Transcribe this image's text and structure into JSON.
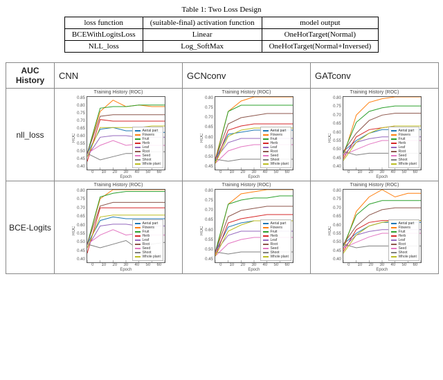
{
  "caption": "Table 1: Two Loss Design",
  "top_table": {
    "headers": [
      "loss function",
      "(suitable-final) activation function",
      "model output"
    ],
    "rows": [
      [
        "BCEWithLogitsLoss",
        "Linear",
        "OneHotTarget(Normal)"
      ],
      [
        "NLL_loss",
        "Log_SoftMax",
        "OneHotTarget(Normal+Inversed)"
      ]
    ]
  },
  "grid": {
    "corner": "AUC History",
    "cols": [
      "CNN",
      "GCNconv",
      "GATconv"
    ],
    "rows": [
      "nll_loss",
      "BCE-Logits"
    ]
  },
  "legend_labels": [
    "Aerial part",
    "Flowers",
    "Fruit",
    "Herb",
    "Leaf",
    "Root",
    "Seed",
    "Shoot",
    "Whole plant"
  ],
  "legend_colors": [
    "#1f77b4",
    "#ff7f0e",
    "#2ca02c",
    "#d62728",
    "#9467bd",
    "#8c564b",
    "#e377c2",
    "#7f7f7f",
    "#bcbd22"
  ],
  "chart_meta": {
    "title": "Training History (ROC)",
    "xlabel": "Epoch",
    "ylabel": "ROC",
    "xticks": [
      "0",
      "10",
      "20",
      "30",
      "40",
      "50",
      "60"
    ]
  },
  "chart_data": [
    {
      "row": "nll_loss",
      "col": "CNN",
      "type": "line",
      "x": [
        0,
        10,
        20,
        30,
        40,
        50,
        60
      ],
      "ylim": [
        0.4,
        0.85
      ],
      "yticks": [
        "0.85",
        "0.80",
        "0.75",
        "0.70",
        "0.65",
        "0.60",
        "0.55",
        "0.50",
        "0.45",
        "0.40"
      ],
      "series": [
        {
          "name": "Aerial part",
          "values": [
            0.5,
            0.65,
            0.66,
            0.64,
            0.64,
            0.63,
            0.63
          ]
        },
        {
          "name": "Flowers",
          "values": [
            0.5,
            0.76,
            0.83,
            0.79,
            0.8,
            0.79,
            0.79
          ]
        },
        {
          "name": "Fruit",
          "values": [
            0.5,
            0.78,
            0.79,
            0.79,
            0.8,
            0.8,
            0.8
          ]
        },
        {
          "name": "Herb",
          "values": [
            0.45,
            0.71,
            0.7,
            0.7,
            0.7,
            0.7,
            0.7
          ]
        },
        {
          "name": "Leaf",
          "values": [
            0.48,
            0.6,
            0.61,
            0.61,
            0.6,
            0.6,
            0.6
          ]
        },
        {
          "name": "Root",
          "values": [
            0.5,
            0.73,
            0.74,
            0.74,
            0.74,
            0.74,
            0.74
          ]
        },
        {
          "name": "Seed",
          "values": [
            0.5,
            0.55,
            0.58,
            0.55,
            0.56,
            0.55,
            0.55
          ]
        },
        {
          "name": "Shoot",
          "values": [
            0.5,
            0.46,
            0.48,
            0.5,
            0.5,
            0.51,
            0.51
          ]
        },
        {
          "name": "Whole plant",
          "values": [
            0.48,
            0.66,
            0.66,
            0.66,
            0.66,
            0.67,
            0.67
          ]
        }
      ]
    },
    {
      "row": "nll_loss",
      "col": "GCNconv",
      "type": "line",
      "x": [
        0,
        10,
        20,
        30,
        40,
        50,
        60
      ],
      "ylim": [
        0.45,
        0.8
      ],
      "yticks": [
        "0.80",
        "0.75",
        "0.70",
        "0.65",
        "0.60",
        "0.55",
        "0.50",
        "0.45"
      ],
      "series": [
        {
          "name": "Aerial part",
          "values": [
            0.5,
            0.62,
            0.63,
            0.64,
            0.64,
            0.64,
            0.64
          ]
        },
        {
          "name": "Flowers",
          "values": [
            0.5,
            0.73,
            0.78,
            0.8,
            0.8,
            0.8,
            0.8
          ]
        },
        {
          "name": "Fruit",
          "values": [
            0.49,
            0.73,
            0.76,
            0.76,
            0.76,
            0.76,
            0.76
          ]
        },
        {
          "name": "Herb",
          "values": [
            0.48,
            0.64,
            0.66,
            0.67,
            0.67,
            0.67,
            0.67
          ]
        },
        {
          "name": "Leaf",
          "values": [
            0.5,
            0.58,
            0.6,
            0.6,
            0.6,
            0.6,
            0.6
          ]
        },
        {
          "name": "Root",
          "values": [
            0.5,
            0.67,
            0.7,
            0.71,
            0.72,
            0.72,
            0.72
          ]
        },
        {
          "name": "Seed",
          "values": [
            0.48,
            0.54,
            0.56,
            0.57,
            0.57,
            0.57,
            0.57
          ]
        },
        {
          "name": "Shoot",
          "values": [
            0.5,
            0.49,
            0.5,
            0.5,
            0.5,
            0.5,
            0.5
          ]
        },
        {
          "name": "Whole plant",
          "values": [
            0.48,
            0.61,
            0.64,
            0.65,
            0.65,
            0.65,
            0.65
          ]
        }
      ]
    },
    {
      "row": "nll_loss",
      "col": "GATconv",
      "type": "line",
      "x": [
        0,
        10,
        20,
        30,
        40,
        50,
        60
      ],
      "ylim": [
        0.4,
        0.8
      ],
      "yticks": [
        "0.80",
        "0.75",
        "0.70",
        "0.65",
        "0.60",
        "0.55",
        "0.50",
        "0.45",
        "0.40"
      ],
      "series": [
        {
          "name": "Aerial part",
          "values": [
            0.5,
            0.56,
            0.6,
            0.62,
            0.62,
            0.62,
            0.62
          ]
        },
        {
          "name": "Flowers",
          "values": [
            0.47,
            0.7,
            0.77,
            0.79,
            0.8,
            0.8,
            0.8
          ]
        },
        {
          "name": "Fruit",
          "values": [
            0.49,
            0.66,
            0.72,
            0.74,
            0.75,
            0.75,
            0.75
          ]
        },
        {
          "name": "Herb",
          "values": [
            0.46,
            0.58,
            0.62,
            0.63,
            0.64,
            0.64,
            0.64
          ]
        },
        {
          "name": "Leaf",
          "values": [
            0.48,
            0.55,
            0.57,
            0.58,
            0.58,
            0.58,
            0.58
          ]
        },
        {
          "name": "Root",
          "values": [
            0.5,
            0.6,
            0.67,
            0.7,
            0.71,
            0.71,
            0.71
          ]
        },
        {
          "name": "Seed",
          "values": [
            0.48,
            0.51,
            0.54,
            0.56,
            0.56,
            0.56,
            0.56
          ]
        },
        {
          "name": "Shoot",
          "values": [
            0.5,
            0.48,
            0.49,
            0.49,
            0.49,
            0.49,
            0.49
          ]
        },
        {
          "name": "Whole plant",
          "values": [
            0.45,
            0.55,
            0.6,
            0.63,
            0.64,
            0.64,
            0.64
          ]
        }
      ]
    },
    {
      "row": "BCE-Logits",
      "col": "CNN",
      "type": "line",
      "x": [
        0,
        10,
        20,
        30,
        40,
        50,
        60
      ],
      "ylim": [
        0.4,
        0.8
      ],
      "yticks": [
        "0.80",
        "0.75",
        "0.70",
        "0.65",
        "0.60",
        "0.55",
        "0.50",
        "0.45",
        "0.40"
      ],
      "series": [
        {
          "name": "Aerial part",
          "values": [
            0.5,
            0.63,
            0.65,
            0.64,
            0.64,
            0.64,
            0.64
          ]
        },
        {
          "name": "Flowers",
          "values": [
            0.5,
            0.75,
            0.8,
            0.8,
            0.8,
            0.8,
            0.8
          ]
        },
        {
          "name": "Fruit",
          "values": [
            0.5,
            0.76,
            0.78,
            0.79,
            0.79,
            0.79,
            0.79
          ]
        },
        {
          "name": "Herb",
          "values": [
            0.45,
            0.7,
            0.7,
            0.7,
            0.7,
            0.7,
            0.7
          ]
        },
        {
          "name": "Leaf",
          "values": [
            0.48,
            0.6,
            0.61,
            0.61,
            0.6,
            0.6,
            0.6
          ]
        },
        {
          "name": "Root",
          "values": [
            0.5,
            0.71,
            0.73,
            0.73,
            0.73,
            0.73,
            0.73
          ]
        },
        {
          "name": "Seed",
          "values": [
            0.5,
            0.55,
            0.58,
            0.55,
            0.56,
            0.55,
            0.55
          ]
        },
        {
          "name": "Shoot",
          "values": [
            0.5,
            0.48,
            0.5,
            0.52,
            0.47,
            0.5,
            0.51
          ]
        },
        {
          "name": "Whole plant",
          "values": [
            0.48,
            0.65,
            0.66,
            0.66,
            0.66,
            0.66,
            0.66
          ]
        }
      ]
    },
    {
      "row": "BCE-Logits",
      "col": "GCNconv",
      "type": "line",
      "x": [
        0,
        10,
        20,
        30,
        40,
        50,
        60
      ],
      "ylim": [
        0.45,
        0.8
      ],
      "yticks": [
        "0.80",
        "0.75",
        "0.70",
        "0.65",
        "0.60",
        "0.55",
        "0.50",
        "0.45"
      ],
      "series": [
        {
          "name": "Aerial part",
          "values": [
            0.5,
            0.62,
            0.64,
            0.65,
            0.65,
            0.65,
            0.65
          ]
        },
        {
          "name": "Flowers",
          "values": [
            0.49,
            0.73,
            0.78,
            0.79,
            0.8,
            0.8,
            0.8
          ]
        },
        {
          "name": "Fruit",
          "values": [
            0.5,
            0.73,
            0.75,
            0.76,
            0.76,
            0.77,
            0.77
          ]
        },
        {
          "name": "Herb",
          "values": [
            0.48,
            0.64,
            0.66,
            0.67,
            0.68,
            0.68,
            0.68
          ]
        },
        {
          "name": "Leaf",
          "values": [
            0.5,
            0.58,
            0.6,
            0.6,
            0.6,
            0.6,
            0.6
          ]
        },
        {
          "name": "Root",
          "values": [
            0.5,
            0.67,
            0.7,
            0.71,
            0.72,
            0.72,
            0.72
          ]
        },
        {
          "name": "Seed",
          "values": [
            0.48,
            0.54,
            0.56,
            0.57,
            0.57,
            0.57,
            0.57
          ]
        },
        {
          "name": "Shoot",
          "values": [
            0.5,
            0.49,
            0.5,
            0.5,
            0.5,
            0.5,
            0.5
          ]
        },
        {
          "name": "Whole plant",
          "values": [
            0.48,
            0.6,
            0.63,
            0.65,
            0.65,
            0.65,
            0.65
          ]
        }
      ]
    },
    {
      "row": "BCE-Logits",
      "col": "GATconv",
      "type": "line",
      "x": [
        0,
        10,
        20,
        30,
        40,
        50,
        60
      ],
      "ylim": [
        0.4,
        0.8
      ],
      "yticks": [
        "0.80",
        "0.75",
        "0.70",
        "0.65",
        "0.60",
        "0.55",
        "0.50",
        "0.45",
        "0.40"
      ],
      "series": [
        {
          "name": "Aerial part",
          "values": [
            0.5,
            0.56,
            0.6,
            0.62,
            0.62,
            0.62,
            0.62
          ]
        },
        {
          "name": "Flowers",
          "values": [
            0.47,
            0.68,
            0.76,
            0.8,
            0.76,
            0.78,
            0.78
          ]
        },
        {
          "name": "Fruit",
          "values": [
            0.49,
            0.66,
            0.72,
            0.74,
            0.74,
            0.74,
            0.74
          ]
        },
        {
          "name": "Herb",
          "values": [
            0.46,
            0.58,
            0.62,
            0.63,
            0.63,
            0.63,
            0.63
          ]
        },
        {
          "name": "Leaf",
          "values": [
            0.48,
            0.55,
            0.57,
            0.58,
            0.58,
            0.58,
            0.58
          ]
        },
        {
          "name": "Root",
          "values": [
            0.5,
            0.6,
            0.66,
            0.69,
            0.7,
            0.7,
            0.7
          ]
        },
        {
          "name": "Seed",
          "values": [
            0.48,
            0.51,
            0.54,
            0.56,
            0.56,
            0.56,
            0.56
          ]
        },
        {
          "name": "Shoot",
          "values": [
            0.5,
            0.48,
            0.49,
            0.49,
            0.49,
            0.49,
            0.49
          ]
        },
        {
          "name": "Whole plant",
          "values": [
            0.45,
            0.55,
            0.6,
            0.62,
            0.63,
            0.63,
            0.63
          ]
        }
      ]
    }
  ]
}
